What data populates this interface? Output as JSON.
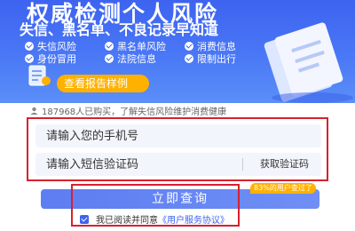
{
  "banner": {
    "title": "权威检测个人风险",
    "subtitle": "失信、黑名单、不良记录早知道",
    "features": [
      "失信风险",
      "黑名单风险",
      "消费信息",
      "身份冒用",
      "法院信息",
      "限制出行"
    ],
    "report_button": "查看报告样例"
  },
  "info": {
    "text": "187968人已购买，了解失信风险维护消费健康"
  },
  "form": {
    "phone_placeholder": "请输入您的手机号",
    "code_placeholder": "请输入短信验证码",
    "get_code_label": "获取验证码"
  },
  "submit": {
    "label": "立即查询",
    "badge": "83%的用户查过了"
  },
  "agreement": {
    "prefix": "我已阅读并同意",
    "link": "《用户服务协议》"
  },
  "colors": {
    "brand_blue": "#3d63f0",
    "accent_orange": "#ffb100",
    "highlight_red": "#d8202f"
  }
}
